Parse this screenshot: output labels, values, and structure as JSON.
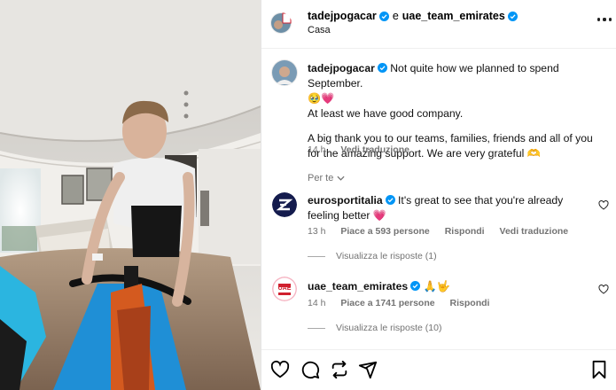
{
  "post": {
    "author": "tadejpogacar",
    "and_word": "e",
    "collaborator": "uae_team_emirates",
    "location": "Casa"
  },
  "caption": {
    "user": "tadejpogacar",
    "line1": "Not quite how we planned to spend September.",
    "emojis1": "🥹💗",
    "line2": "At least we have good company.",
    "line3": "A big thank you to our teams, families, friends and all of you for the amazing support. We are very grateful 🫶",
    "time": "14 h",
    "see_translation": "Vedi traduzione"
  },
  "sort_label": "Per te",
  "comments": [
    {
      "user": "eurosportitalia",
      "text": "It's great to see that you're already feeling better 💗",
      "time": "13 h",
      "likes": "Piace a 593 persone",
      "reply": "Rispondi",
      "see_translation": "Vedi traduzione",
      "view_replies": "Visualizza le risposte (1)"
    },
    {
      "user": "uae_team_emirates",
      "text": "🙏🤟",
      "time": "14 h",
      "likes": "Piace a 1741 persone",
      "reply": "Rispondi",
      "view_replies": "Visualizza le risposte (10)"
    }
  ],
  "uae_logo_text": "UAE",
  "icons": {
    "like": "heart-icon",
    "comment": "comment-icon",
    "share": "repost-icon",
    "send": "send-icon",
    "save": "bookmark-icon",
    "verified": "verified-badge-icon",
    "more": "more-options-icon"
  },
  "colors": {
    "verified": "#0095f6",
    "muted": "#737373",
    "eurosport": "#141b4d",
    "uae_red": "#d0202f"
  }
}
